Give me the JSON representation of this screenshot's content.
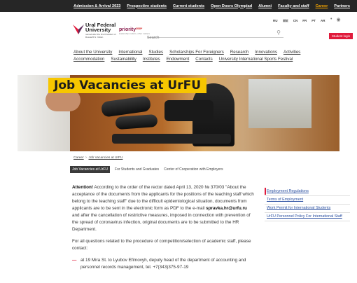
{
  "top_nav": [
    {
      "label": "Admission & Arrival 2023",
      "active": false
    },
    {
      "label": "Prospective students",
      "active": false
    },
    {
      "label": "Current students",
      "active": false
    },
    {
      "label": "Open Doors Olympiad",
      "active": false
    },
    {
      "label": "Alumni",
      "active": false
    },
    {
      "label": "Faculty and staff",
      "active": false
    },
    {
      "label": "Career",
      "active": true
    },
    {
      "label": "Partners",
      "active": false
    }
  ],
  "logo": {
    "line1": "Ural Federal",
    "line2": "University",
    "sub": "named after the first President of Russia B.N. Yeltsin"
  },
  "priority": {
    "name": "priority",
    "suffix": "2030*",
    "sub": "leadership matters, other matters"
  },
  "search": {
    "placeholder": "Search"
  },
  "languages": [
    "RU",
    "EN",
    "CN",
    "FR",
    "PT",
    "AR"
  ],
  "languages_current": "EN",
  "student_login": "Student login",
  "main_menu_row1": [
    "About the University",
    "International",
    "Studies",
    "Scholarships For Foreigners",
    "Research",
    "Innovations",
    "Activities"
  ],
  "main_menu_row2": [
    "Accommodation",
    "Sustainability",
    "Institutes",
    "Endowment",
    "Contacts",
    "University International Sports Festival"
  ],
  "hero_title": "Job Vacancies at UrFU",
  "breadcrumb": [
    "Career",
    "Job Vacancies at UrFU"
  ],
  "subtabs": [
    "Job Vacancies at UrFU",
    "For Students and Graduates",
    "Center of Cooperation with Employers"
  ],
  "content": {
    "attention_label": "Attention!",
    "attention_text_1": " According to the order of the rector dated April 13, 2020 № 370/03 \"About the acceptance of the documents from the applicants for the positions of the teaching staff which belong to the teaching staff\" due to the difficult epidemiological situation, documents from applicants are to be sent in the electronic form as PDF to the e-mail ",
    "email": "spravka.hr@urfu.ru",
    "attention_text_2": " and after the cancellation of restrictive measures, imposed in connection with prevention of the spread of coronavirus infection, original documents are to be submitted to the HR Department.",
    "para2": "For all questions related to the procedure of competition/selection of academic staff, please contact:",
    "bullet1": "at 19 Mira St. to Lyubov Efimovyh, deputy head of the department of accounting and personnel records management, tel. +7(343)375-97-19"
  },
  "side_links": [
    "Employment Regulations",
    "Terms of Employment",
    "Work Permit for International Students",
    "UrFU Personnel Policy For International Staff"
  ],
  "colors": {
    "topbar": "#262626",
    "active_nav": "#f7a600",
    "accent_red": "#e01a3b",
    "hero_title_bg": "#f7c600",
    "link_blue": "#2a4fa0"
  }
}
